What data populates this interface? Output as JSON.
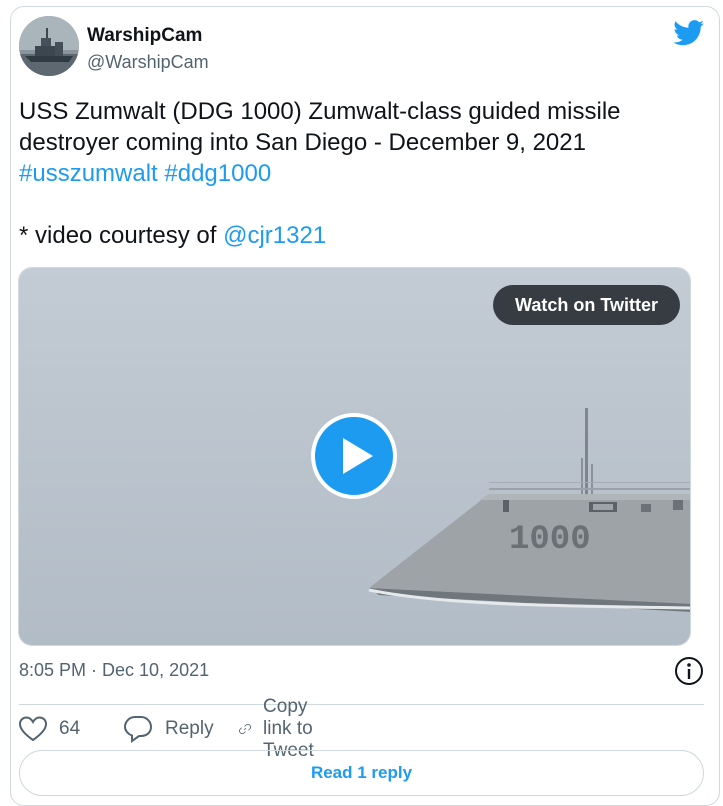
{
  "author": {
    "display_name": "WarshipCam",
    "handle": "@WarshipCam"
  },
  "tweet": {
    "line1": "USS Zumwalt (DDG 1000) Zumwalt-class guided missile destroyer coming into San Diego - December 9, 2021",
    "hashtags": "#usszumwalt #ddg1000",
    "courtesy_prefix": "* video courtesy of ",
    "courtesy_mention": "@cjr1321"
  },
  "media": {
    "watch_label": "Watch on Twitter",
    "hull_number": "1000"
  },
  "timestamp": "8:05 PM · Dec 10, 2021",
  "actions": {
    "like_count": "64",
    "reply_label": "Reply",
    "copy_label": "Copy link to Tweet"
  },
  "read_reply_label": "Read 1 reply",
  "colors": {
    "accent": "#1d9bf0",
    "secondary_text": "#536471",
    "border": "#cfd9de"
  }
}
